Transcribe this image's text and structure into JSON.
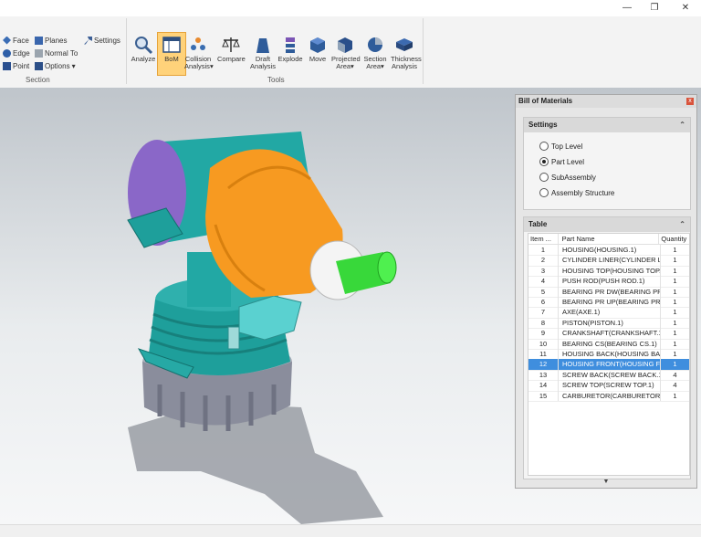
{
  "window": {
    "minimize": "—",
    "maximize": "❐",
    "close": "✕"
  },
  "ribbon": {
    "section": {
      "label": "Section",
      "face": "Face",
      "edge": "Edge",
      "point": "Point",
      "planes": "Planes",
      "normal_to": "Normal To",
      "options": "Options",
      "settings": "Settings"
    },
    "tools": {
      "label": "Tools",
      "analyze": "Analyze",
      "bom": "BoM",
      "collision": "Collision",
      "collision2": "Analysis",
      "compare": "Compare",
      "draft": "Draft",
      "draft2": "Analysis",
      "explode": "Explode",
      "move": "Move",
      "projected": "Projected",
      "projected2": "Area",
      "section_area": "Section",
      "section_area2": "Area",
      "thickness": "Thickness",
      "thickness2": "Analysis"
    }
  },
  "bom": {
    "title": "Bill of Materials",
    "close": "x",
    "settings": {
      "title": "Settings",
      "options": [
        "Top Level",
        "Part Level",
        "SubAssembly",
        "Assembly Structure"
      ],
      "selected": "Part Level"
    },
    "table": {
      "title": "Table",
      "columns": {
        "item": "Item ...",
        "part": "Part Name",
        "qty": "Quantity"
      },
      "rows": [
        {
          "item": "1",
          "part": "HOUSING(HOUSING.1)",
          "qty": "1"
        },
        {
          "item": "2",
          "part": "CYLINDER LINER(CYLINDER LI...",
          "qty": "1"
        },
        {
          "item": "3",
          "part": "HOUSING TOP(HOUSING TOP....",
          "qty": "1"
        },
        {
          "item": "4",
          "part": "PUSH ROD(PUSH ROD.1)",
          "qty": "1"
        },
        {
          "item": "5",
          "part": "BEARING PR DW(BEARING PR ...",
          "qty": "1"
        },
        {
          "item": "6",
          "part": "BEARING PR UP(BEARING PR ...",
          "qty": "1"
        },
        {
          "item": "7",
          "part": "AXE(AXE.1)",
          "qty": "1"
        },
        {
          "item": "8",
          "part": "PISTON(PISTON.1)",
          "qty": "1"
        },
        {
          "item": "9",
          "part": "CRANKSHAFT(CRANKSHAFT.1)",
          "qty": "1"
        },
        {
          "item": "10",
          "part": "BEARING CS(BEARING CS.1)",
          "qty": "1"
        },
        {
          "item": "11",
          "part": "HOUSING BACK(HOUSING BA...",
          "qty": "1"
        },
        {
          "item": "12",
          "part": "HOUSING FRONT(HOUSING F...",
          "qty": "1"
        },
        {
          "item": "13",
          "part": "SCREW BACK(SCREW BACK.1)",
          "qty": "4"
        },
        {
          "item": "14",
          "part": "SCREW TOP(SCREW TOP.1)",
          "qty": "4"
        },
        {
          "item": "15",
          "part": "CARBURETOR(CARBURETOR.1)",
          "qty": "1"
        }
      ],
      "selected_item": "12"
    },
    "scroll_down": "▼"
  },
  "colors": {
    "accent": "#3f8ede",
    "active_tool": "#ffd27a"
  }
}
